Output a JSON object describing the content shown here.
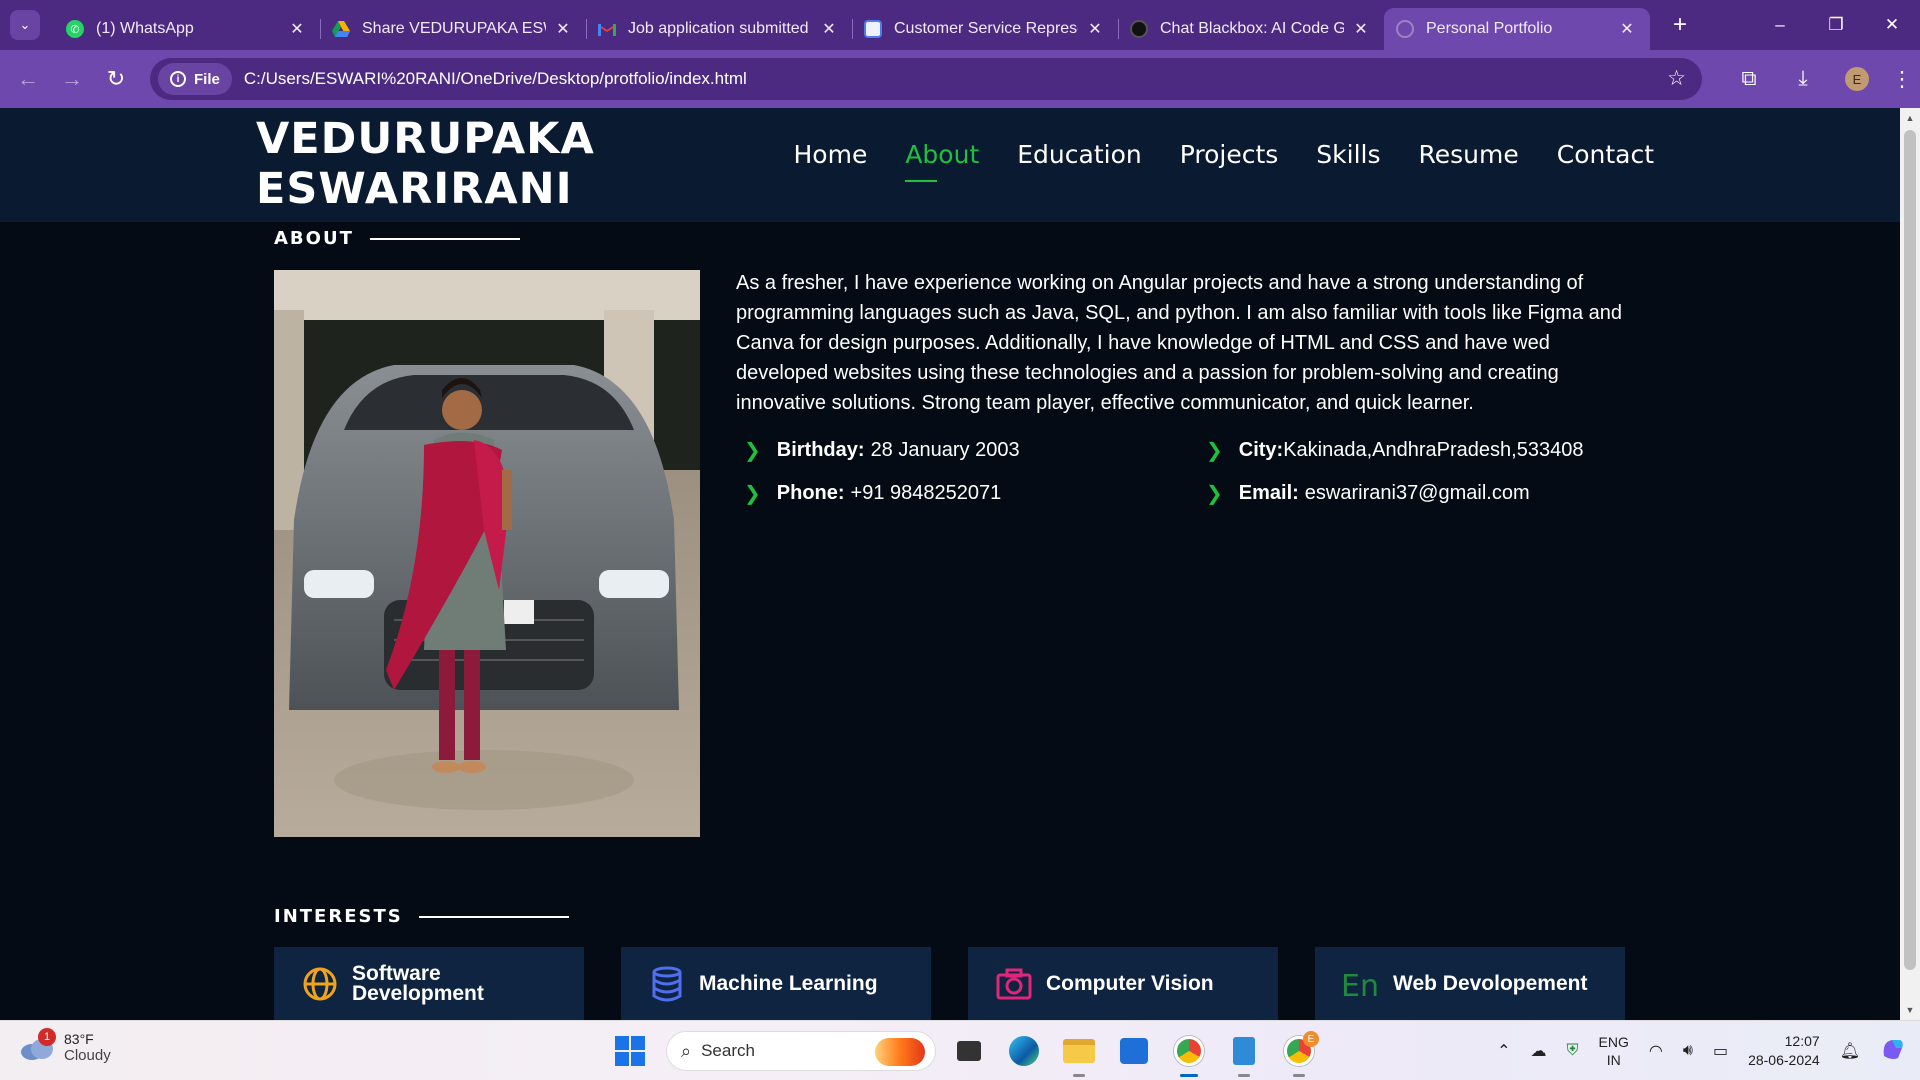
{
  "browser": {
    "tabs": [
      {
        "title": "(1) WhatsApp",
        "favicon": "whatsapp-icon",
        "color": "#25d366",
        "active": false
      },
      {
        "title": "Share VEDURUPAKA ESWA",
        "favicon": "google-drive-icon",
        "color": "#f4b400",
        "active": false
      },
      {
        "title": "Job application submitted",
        "favicon": "gmail-icon",
        "color": "#ea4335",
        "active": false
      },
      {
        "title": "Customer Service Represen",
        "favicon": "form-icon",
        "color": "#4d7cf0",
        "active": false
      },
      {
        "title": "Chat Blackbox: AI Code Ge",
        "favicon": "blackbox-icon",
        "color": "#111111",
        "active": false
      },
      {
        "title": "Personal Portfolio",
        "favicon": "globe-icon",
        "color": "#9a85c2",
        "active": true
      }
    ],
    "address": {
      "scheme_chip": "File",
      "url": "C:/Users/ESWARI%20RANI/OneDrive/Desktop/protfolio/index.html"
    },
    "profile_initial": "E",
    "theme_color": "#6f48ad"
  },
  "site": {
    "logo_line1": "VEDURUPAKA",
    "logo_line2": "ESWARIRANI",
    "nav": [
      {
        "label": "Home",
        "active": false
      },
      {
        "label": "About",
        "active": true
      },
      {
        "label": "Education",
        "active": false
      },
      {
        "label": "Projects",
        "active": false
      },
      {
        "label": "Skills",
        "active": false
      },
      {
        "label": "Resume",
        "active": false
      },
      {
        "label": "Contact",
        "active": false
      }
    ],
    "accent_color": "#1ec03f"
  },
  "about": {
    "section_title": "ABOUT",
    "paragraph": "As a fresher, I have experience working on Angular projects and have a strong understanding of programming languages such as Java, SQL, and python. I am also familiar with tools like Figma and Canva for design purposes. Additionally, I have knowledge of HTML and CSS and have wed developed websites using these technologies and a passion for problem-solving and creating innovative solutions. Strong team player, effective communicator, and quick learner.",
    "details": {
      "birthday_label": "Birthday:",
      "birthday_value": "28 January 2003",
      "city_label": "City:",
      "city_value": "Kakinada,AndhraPradesh,533408",
      "phone_label": "Phone:",
      "phone_value": "+91 9848252071",
      "email_label": "Email:",
      "email_value": "eswarirani37@gmail.com"
    }
  },
  "interests": {
    "section_title": "INTERESTS",
    "items": [
      {
        "line1": "Software",
        "line2": "Development",
        "icon": "globe-icon",
        "color": "#f0a41e"
      },
      {
        "line1": "Machine Learning",
        "line2": "",
        "icon": "database-icon",
        "color": "#4f6ff0"
      },
      {
        "line1": "Computer Vision",
        "line2": "",
        "icon": "camera-icon",
        "color": "#e0267a"
      },
      {
        "line1": "Web Devolopement",
        "line2": "",
        "icon": "language-icon",
        "color": "#1e8a3a"
      }
    ]
  },
  "taskbar": {
    "weather_badge": "1",
    "temperature": "83°F",
    "condition": "Cloudy",
    "search_placeholder": "Search",
    "lang_line1": "ENG",
    "lang_line2": "IN",
    "time": "12:07",
    "date": "28-06-2024",
    "chrome_badge": "E"
  }
}
